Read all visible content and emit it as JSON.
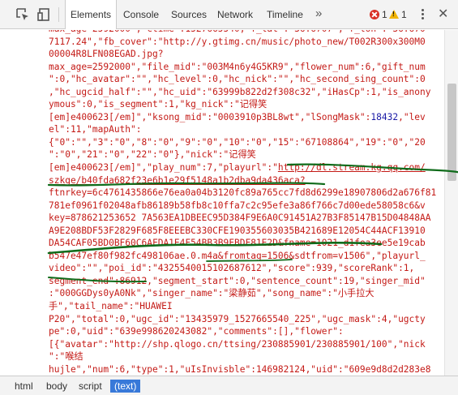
{
  "toolbar": {
    "tabs": [
      "Elements",
      "Console",
      "Sources",
      "Network",
      "Timeline"
    ],
    "active_tab": "Elements",
    "more_glyph": "»",
    "error_count": "1",
    "warning_count": "1",
    "close_glyph": "✕"
  },
  "code": {
    "lines": [
      {
        "p": [
          [
            "s",
            "max_age=2592000\",\"ctime\":1527665540,\"f_lat\":\"36.6707\",\"f_lon\":\"36.670"
          ]
        ]
      },
      {
        "p": [
          [
            "s",
            "7117.24\",\"fb_cover\":\"http://y.gtimg.cn/music/photo_new/T002R300x300M0"
          ]
        ]
      },
      {
        "p": [
          [
            "s",
            "00004R8LFN08EGAD.jpg?"
          ]
        ]
      },
      {
        "p": [
          [
            "s",
            "max_age=2592000\",\"file_mid\":\"003M4n6y4G5KR9\",\"flower_num\":6,\"gift_num"
          ]
        ]
      },
      {
        "p": [
          [
            "s",
            "\":0,\"hc_avatar\":\"\",\"hc_level\":0,\"hc_nick\":\"\",\"hc_second_sing_count\":0"
          ]
        ]
      },
      {
        "p": [
          [
            "s",
            ",\"hc_ugcid_half\":\"\",\"hc_uid\":\"63999b822d2f308c32\",\"iHasCp\":1,\"is_anony"
          ]
        ]
      },
      {
        "p": [
          [
            "s",
            "ymous\":0,\"is_segment\":1,\"kg_nick\":\"记得笑"
          ]
        ]
      },
      {
        "p": [
          [
            "s",
            "[em]e400623[/em]\",\"ksong_mid\":\"0003910p3BL8wt\",\"lSongMask\":"
          ],
          [
            "n",
            "18432"
          ],
          [
            "s",
            ",\"lev"
          ]
        ]
      },
      {
        "p": [
          [
            "s",
            "el\":11,\"mapAuth\":"
          ]
        ]
      },
      {
        "p": [
          [
            "s",
            "{\"0\":\"\",\"3\":\"0\",\"8\":\"0\",\"9\":\"0\",\"10\":\"0\",\"15\":\"67108864\",\"19\":\"0\",\"20"
          ]
        ]
      },
      {
        "p": [
          [
            "s",
            "\":\"0\",\"21\":\"0\",\"22\":\"0\"},\"nick\":\"记得笑"
          ]
        ]
      },
      {
        "p": [
          [
            "s",
            "[em]e400623[/em]\",\"play_num\":7,\"playurl\":\""
          ],
          [
            "u",
            "http://dl.stream.kg.qq.com/"
          ]
        ]
      },
      {
        "p": [
          [
            "u",
            "szkge/b40fda682f23e6b1e29f5148a1b2dba9da436aca?"
          ]
        ]
      },
      {
        "p": [
          [
            "s",
            "ftnrkey=6c4761435866e76ea0a04b3120fc89a765cc7fd8d6299e18907806d2a676f81"
          ]
        ]
      },
      {
        "p": [
          [
            "s",
            "781ef0961f02048afb86189b58fb8c10ffa7c2c95efe3a86f766c7d00ede58058c6&v"
          ]
        ]
      },
      {
        "p": [
          [
            "s",
            "key=878621253652 7A563EA1DBEEC95D384F9E6A0C91451A27B3F85147B15D04848AA"
          ]
        ]
      },
      {
        "p": [
          [
            "s",
            "A9E208BDF53F2829F685F8EEEBC330CFE190355603035B421689E12054C44ACF13910"
          ]
        ]
      },
      {
        "p": [
          [
            "s",
            "DA54CAF05BD0BF60C6AFDA1E4F54BB3B9FBDF81E2D&fname=1021_d1fea3ee5e19cab"
          ]
        ]
      },
      {
        "p": [
          [
            "s",
            "b547e47ef80f982fc498106ae.0.m4a&fromtag=1506&sdtfrom=v1506\",\"playurl_"
          ]
        ]
      },
      {
        "p": [
          [
            "s",
            "video\":\"\",\"poi_id\":\"4325540015102687612\",\"score\":939,\"scoreRank\":1,"
          ]
        ]
      },
      {
        "p": [
          [
            "s",
            "segment_end\":86912,\"segment_start\":0,\"sentence_count\":19,\"singer_mid\""
          ]
        ]
      },
      {
        "p": [
          [
            "s",
            ":\"000GGDys0yA0Nk\",\"singer_name\":\"梁静茹\",\"song_name\":\"小手拉大"
          ]
        ]
      },
      {
        "p": [
          [
            "s",
            "手\",\"tail_name\":\"HUAWEI"
          ]
        ]
      },
      {
        "p": [
          [
            "s",
            "P20\",\"total\":0,\"ugc_id\":\"13435979_1527665540_225\",\"ugc_mask\":4,\"ugcty"
          ]
        ]
      },
      {
        "p": [
          [
            "s",
            "pe\":0,\"uid\":\"639e998620243082\",\"comments\":[],\"flower\":"
          ]
        ]
      },
      {
        "p": [
          [
            "s",
            "[{\"avatar\":\"http://shp.qlogo.cn/ttsing/230885901/230885901/100\",\"nick"
          ]
        ]
      },
      {
        "p": [
          [
            "s",
            "\":\"喉结"
          ]
        ]
      },
      {
        "p": [
          [
            "s",
            "hujle\",\"num\":6,\"type\":1,\"uIsInvisble\":146982124,\"uid\":\"609e9d8d2d283e8"
          ]
        ]
      },
      {
        "p": [
          [
            "s",
            "b35\"}],\"mapRight\":{},\"not_show_qrc_mask\":0,\"photos\":"
          ]
        ]
      },
      {
        "p": [
          [
            "s",
            "[],\"short_video_tag_id\":\"\"},\"lyric\":null,\"bullet\":null,\"share\":"
          ]
        ]
      }
    ]
  },
  "breadcrumbs": [
    "html",
    "body",
    "script",
    "(text)"
  ],
  "selected_crumb": "(text)"
}
